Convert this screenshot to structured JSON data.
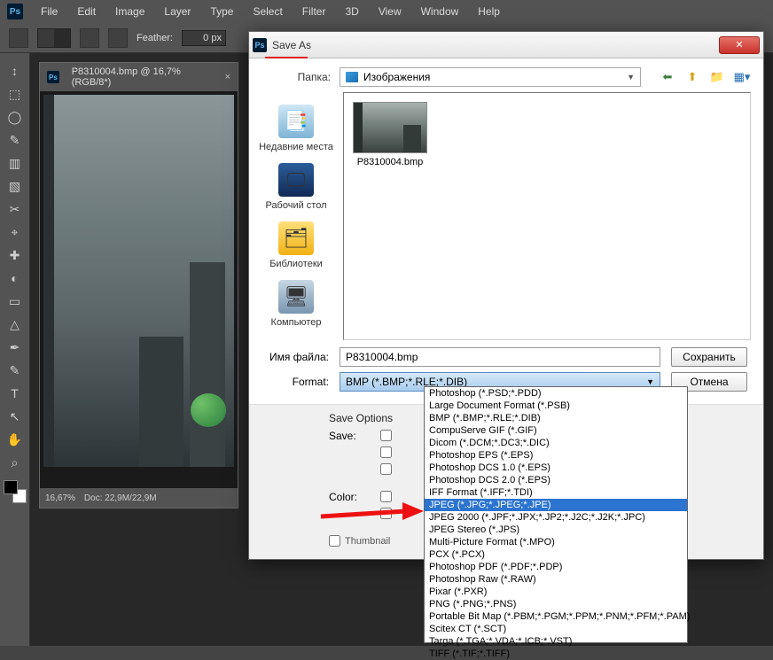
{
  "menubar": {
    "items": [
      "File",
      "Edit",
      "Image",
      "Layer",
      "Type",
      "Select",
      "Filter",
      "3D",
      "View",
      "Window",
      "Help"
    ]
  },
  "optbar": {
    "feather_label": "Feather:",
    "feather_value": "0 px"
  },
  "tools": [
    "↕",
    "⬚",
    "◯",
    "✎",
    "▥",
    "▧",
    "✂",
    "⌖",
    "✚",
    "◐",
    "▭",
    "△",
    "✒",
    "✎",
    "T",
    "↖",
    "✋",
    "⌕"
  ],
  "doc": {
    "title": "P8310004.bmp @ 16,7% (RGB/8*)",
    "zoom": "16,67%",
    "docsize": "Doc: 22,9M/22,9M"
  },
  "dialog": {
    "title": "Save As",
    "folder_label": "Папка:",
    "folder_value": "Изображения",
    "places": {
      "recent": "Недавние места",
      "desktop": "Рабочий стол",
      "libraries": "Библиотеки",
      "computer": "Компьютер"
    },
    "thumb_name": "P8310004.bmp",
    "filename_label": "Имя файла:",
    "filename_value": "P8310004.bmp",
    "format_label": "Format:",
    "format_value": "BMP (*.BMP;*.RLE;*.DIB)",
    "save_btn": "Сохранить",
    "cancel_btn": "Отмена",
    "save_options_title": "Save Options",
    "save_label": "Save:",
    "color_label": "Color:",
    "thumbnail_label": "Thumbnail"
  },
  "format_list": [
    "Photoshop (*.PSD;*.PDD)",
    "Large Document Format (*.PSB)",
    "BMP (*.BMP;*.RLE;*.DIB)",
    "CompuServe GIF (*.GIF)",
    "Dicom (*.DCM;*.DC3;*.DIC)",
    "Photoshop EPS (*.EPS)",
    "Photoshop DCS 1.0 (*.EPS)",
    "Photoshop DCS 2.0 (*.EPS)",
    "IFF Format (*.IFF;*.TDI)",
    "JPEG (*.JPG;*.JPEG;*.JPE)",
    "JPEG 2000 (*.JPF;*.JPX;*.JP2;*.J2C;*.J2K;*.JPC)",
    "JPEG Stereo (*.JPS)",
    "Multi-Picture Format (*.MPO)",
    "PCX (*.PCX)",
    "Photoshop PDF (*.PDF;*.PDP)",
    "Photoshop Raw (*.RAW)",
    "Pixar (*.PXR)",
    "PNG (*.PNG;*.PNS)",
    "Portable Bit Map (*.PBM;*.PGM;*.PPM;*.PNM;*.PFM;*.PAM)",
    "Scitex CT (*.SCT)",
    "Targa (*.TGA;*.VDA;*.ICB;*.VST)",
    "TIFF (*.TIF;*.TIFF)"
  ],
  "format_selected_index": 9
}
